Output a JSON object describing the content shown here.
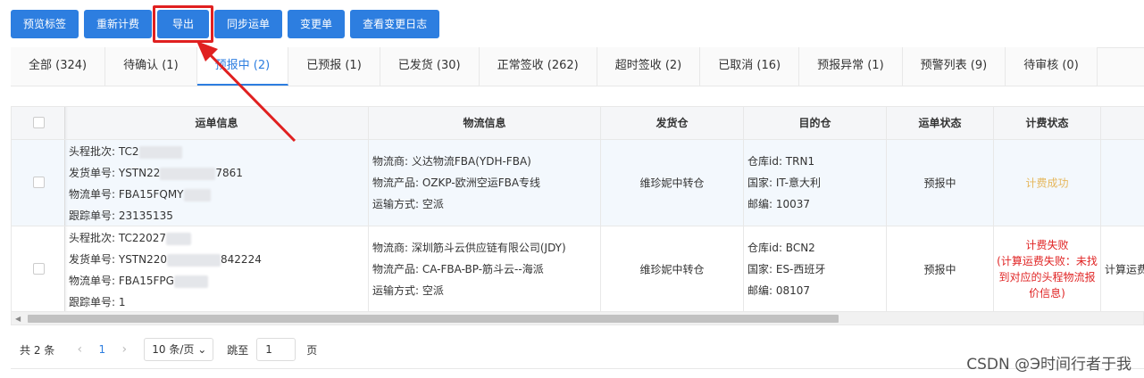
{
  "toolbar": {
    "buttons": [
      "预览标签",
      "重新计费",
      "导出",
      "同步运单",
      "变更单",
      "查看变更日志"
    ]
  },
  "tabs": [
    "全部 (324)",
    "待确认 (1)",
    "预报中 (2)",
    "已预报 (1)",
    "已发货 (30)",
    "正常签收 (262)",
    "超时签收 (2)",
    "已取消 (16)",
    "预报异常 (1)",
    "预警列表 (9)",
    "待审核 (0)"
  ],
  "active_tab": "预报中 (2)",
  "table": {
    "headers": [
      "运单信息",
      "物流信息",
      "发货仓",
      "目的仓",
      "运单状态",
      "计费状态"
    ],
    "rows": [
      {
        "waybill": [
          "头程批次: TC2",
          "发货单号: YSTN22",
          "7861",
          "物流单号: FBA15FQMY",
          "跟踪单号: 23135135"
        ],
        "logistics": [
          "物流商: 义达物流FBA(YDH-FBA)",
          "物流产品: OZKP-欧洲空运FBA专线",
          "运输方式: 空派"
        ],
        "origin": "维珍妮中转仓",
        "dest": [
          "仓库id: TRN1",
          "国家: IT-意大利",
          "邮编: 10037"
        ],
        "status": "预报中",
        "billing": "计费成功",
        "extra": ""
      },
      {
        "waybill": [
          "头程批次: TC22027",
          "发货单号: YSTN220",
          "842224",
          "物流单号: FBA15FPG",
          "跟踪单号: 1"
        ],
        "logistics": [
          "物流商: 深圳筋斗云供应链有限公司(JDY)",
          "物流产品: CA-FBA-BP-筋斗云--海派",
          "运输方式: 空派"
        ],
        "origin": "维珍妮中转仓",
        "dest": [
          "仓库id: BCN2",
          "国家: ES-西班牙",
          "邮编: 08107"
        ],
        "status": "预报中",
        "billing": "计费失败\n(计算运费失败: 未找到对应的头程物流报价信息)",
        "billing_lines": [
          "计费失败",
          "(计算运费失败：未找",
          "到对应的头程物流报",
          "价信息)"
        ],
        "extra": "计算运费"
      }
    ]
  },
  "pagination": {
    "total": "共 2 条",
    "current_page": "1",
    "page_size": "10 条/页",
    "jump_label": "跳至",
    "jump_value": "1",
    "jump_suffix": "页"
  },
  "watermark": "CSDN @Э时间行者于我",
  "colors": {
    "primary": "#2d7ee0",
    "highlight": "#e02020",
    "success_billing": "#e6b75c",
    "fail_billing": "#e02424"
  }
}
